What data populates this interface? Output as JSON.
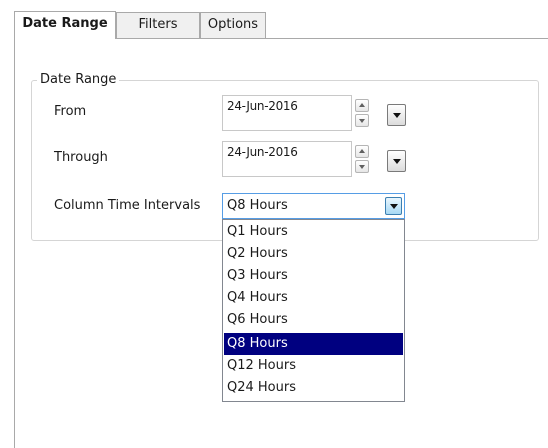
{
  "tabs": [
    {
      "label": "Date Range",
      "active": true
    },
    {
      "label": "Filters",
      "active": false
    },
    {
      "label": "Options",
      "active": false
    }
  ],
  "group": {
    "legend": "Date Range"
  },
  "from": {
    "label": "From",
    "value": "24-Jun-2016"
  },
  "through": {
    "label": "Through",
    "value": "24-Jun-2016"
  },
  "interval": {
    "label": "Column Time Intervals",
    "value": "Q8 Hours",
    "options": [
      "Q1 Hours",
      "Q2 Hours",
      "Q3 Hours",
      "Q4 Hours",
      "Q6 Hours",
      "Q8 Hours",
      "Q12 Hours",
      "Q24 Hours"
    ],
    "selected_index": 5
  },
  "colors": {
    "selection": "#000080",
    "focus_border": "#569de5"
  },
  "icons": {
    "spin_up": "spin-up-icon",
    "spin_down": "spin-down-icon",
    "dropdown": "chevron-down-icon"
  }
}
